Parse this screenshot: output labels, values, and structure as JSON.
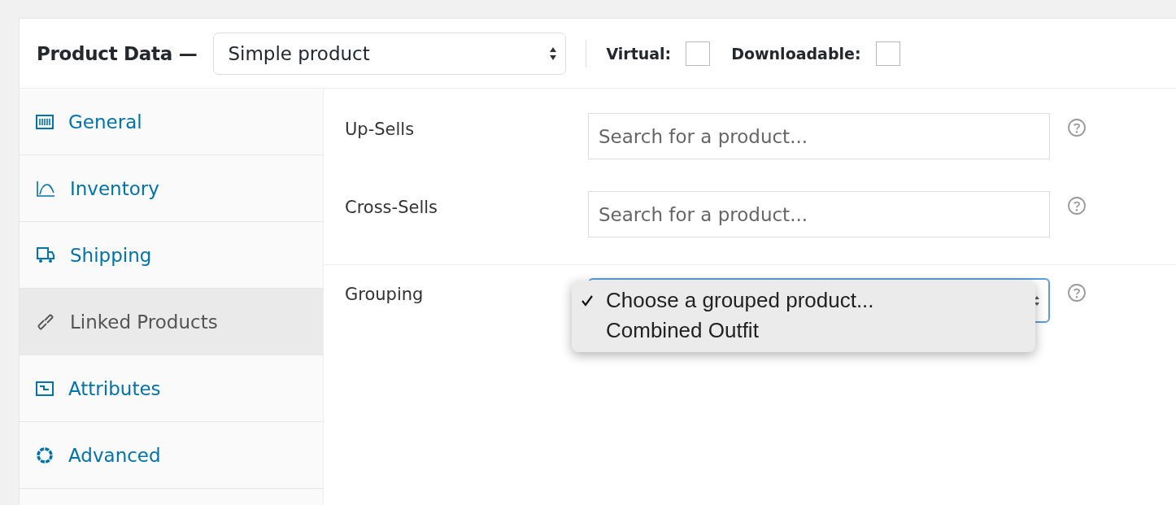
{
  "header": {
    "title": "Product Data —",
    "product_type": "Simple product",
    "options": [
      {
        "label": "Virtual:",
        "checked": false
      },
      {
        "label": "Downloadable:",
        "checked": false
      }
    ]
  },
  "tabs": [
    {
      "label": "General",
      "kind": "general",
      "selected": false
    },
    {
      "label": "Inventory",
      "kind": "inventory",
      "selected": false
    },
    {
      "label": "Shipping",
      "kind": "shipping",
      "selected": false
    },
    {
      "label": "Linked Products",
      "kind": "linked",
      "selected": true
    },
    {
      "label": "Attributes",
      "kind": "attributes",
      "selected": false
    },
    {
      "label": "Advanced",
      "kind": "advanced",
      "selected": false
    }
  ],
  "fields": [
    {
      "label": "Up-Sells",
      "kind": "search",
      "placeholder": "Search for a product..."
    },
    {
      "label": "Cross-Sells",
      "kind": "search",
      "placeholder": "Search for a product..."
    },
    {
      "label": "Grouping",
      "kind": "select",
      "menu": [
        {
          "label": "Choose a grouped product...",
          "checked": true
        },
        {
          "label": "Combined Outfit",
          "checked": false
        }
      ]
    }
  ]
}
